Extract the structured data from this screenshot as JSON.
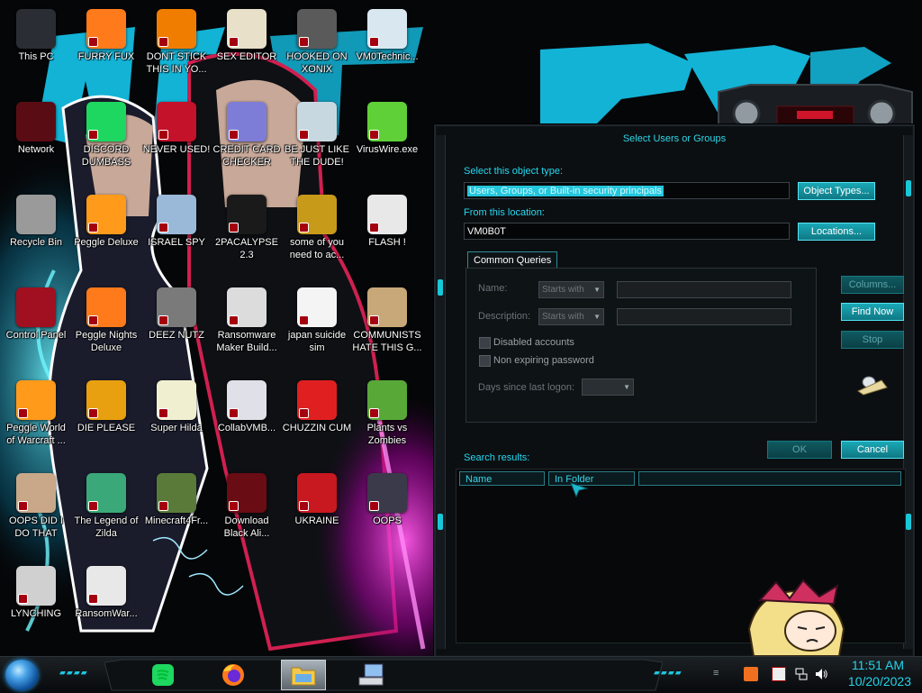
{
  "desktop": {
    "icons": [
      {
        "label": "This PC",
        "icon": "computer-icon",
        "color": "#2a2d33"
      },
      {
        "label": "FURRY FUX",
        "icon": "firefox-icon",
        "color": "#ff7a1a"
      },
      {
        "label": "DONT STICK THIS IN YO...",
        "icon": "vlc-cone-icon",
        "color": "#f07d00"
      },
      {
        "label": "SEX EDITOR",
        "icon": "hxd-editor-icon",
        "color": "#e8e0c8"
      },
      {
        "label": "HOOKED ON XONIX",
        "icon": "xonix-game-icon",
        "color": "#5a5a5a"
      },
      {
        "label": "VM0Technic...",
        "icon": "doctor-icon",
        "color": "#d9e8f0"
      },
      {
        "label": "Network",
        "icon": "network-orb-icon",
        "color": "#5a0c14"
      },
      {
        "label": "DISCORD DUMBASS",
        "icon": "spotify-icon",
        "color": "#1ed760"
      },
      {
        "label": "NEVER USED!",
        "icon": "devcpp-icon",
        "color": "#c4122a"
      },
      {
        "label": "CREDIT CARD CHECKER",
        "icon": "credit-card-icon",
        "color": "#7d7dd8"
      },
      {
        "label": "BE JUST LIKE THE DUDE!",
        "icon": "santa-icon",
        "color": "#c8d8e0"
      },
      {
        "label": "VirusWire.exe",
        "icon": "limewire-icon",
        "color": "#5fd038"
      },
      {
        "label": "Recycle Bin",
        "icon": "recycle-bin-icon",
        "color": "#9a9a9a"
      },
      {
        "label": "Peggle Deluxe",
        "icon": "peggle-icon",
        "color": "#ff9a1a"
      },
      {
        "label": "ISRAEL SPY",
        "icon": "network-card-icon",
        "color": "#9ab8d8"
      },
      {
        "label": "2PACALYPSE 2.3",
        "icon": "terminal-icon",
        "color": "#1a1a1a"
      },
      {
        "label": "some of you need to ac...",
        "icon": "beaver-icon",
        "color": "#c89a1a"
      },
      {
        "label": "FLASH !",
        "icon": "flash-icon",
        "color": "#e8e8e8"
      },
      {
        "label": "Control Panel",
        "icon": "control-panel-icon",
        "color": "#a01020"
      },
      {
        "label": "Peggle Nights Deluxe",
        "icon": "peggle-nights-icon",
        "color": "#ff7a1a"
      },
      {
        "label": "DEEZ NUTZ",
        "icon": "windows-stack-icon",
        "color": "#7a7a7a"
      },
      {
        "label": "Ransomware Maker Build...",
        "icon": "window-app-icon",
        "color": "#dcdcdc"
      },
      {
        "label": "japan suicide sim",
        "icon": "document-icon",
        "color": "#f4f4f4"
      },
      {
        "label": "COMMUNISTS HATE THIS G...",
        "icon": "money-bag-icon",
        "color": "#c8a878"
      },
      {
        "label": "Peggle World of Warcraft ...",
        "icon": "peggle-wow-icon",
        "color": "#ff9a1a"
      },
      {
        "label": "DIE PLEASE",
        "icon": "de-icon",
        "color": "#e8a010"
      },
      {
        "label": "Super Hilda",
        "icon": "pixel-ghost-icon",
        "color": "#f0f0d0"
      },
      {
        "label": "CollabVMB...",
        "icon": "monitor-icon",
        "color": "#e0e0e8"
      },
      {
        "label": "CHUZZIN CUM",
        "icon": "chuzzle-icon",
        "color": "#e02020"
      },
      {
        "label": "Plants vs Zombies",
        "icon": "plant-icon",
        "color": "#58a838"
      },
      {
        "label": "OOPS DID I DO THAT",
        "icon": "portrait-icon",
        "color": "#c8a888"
      },
      {
        "label": "The Legend of Zilda",
        "icon": "zilda-icon",
        "color": "#3aa878"
      },
      {
        "label": "Minecraft4Fr...",
        "icon": "minecraft-block-icon",
        "color": "#5a7a3a"
      },
      {
        "label": "Download Black Ali...",
        "icon": "black-orb-icon",
        "color": "#6a0c14"
      },
      {
        "label": "UKRAINE",
        "icon": "radiation-icon",
        "color": "#c81820"
      },
      {
        "label": "OOPS",
        "icon": "book-icon",
        "color": "#3a3a4a"
      },
      {
        "label": "LYNCHING",
        "icon": "chain-icon",
        "color": "#d0d0d0"
      },
      {
        "label": "RansomWar...",
        "icon": "skull-icon",
        "color": "#e8e8e8"
      }
    ]
  },
  "dialog": {
    "title": "Select Users or Groups",
    "object_type_label": "Select this object type:",
    "object_type_value": "Users, Groups, or Built-in security principals",
    "object_types_button": "Object Types...",
    "location_label": "From this location:",
    "location_value": "VM0B0T",
    "locations_button": "Locations...",
    "tab_label": "Common Queries",
    "name_label": "Name:",
    "name_op": "Starts with",
    "description_label": "Description:",
    "description_op": "Starts with",
    "disabled_accounts": "Disabled accounts",
    "non_expiring_password": "Non expiring password",
    "days_since_label": "Days since last logon:",
    "columns_button": "Columns...",
    "find_now_button": "Find Now",
    "stop_button": "Stop",
    "ok_button": "OK",
    "cancel_button": "Cancel",
    "search_results_label": "Search results:",
    "col_name": "Name",
    "col_in_folder": "In Folder"
  },
  "clock": {
    "time": "11:51 AM",
    "date": "10/20/2023"
  },
  "colors": {
    "accent": "#22d4ea",
    "dialog_bg": "#0c0f12",
    "button": "#1aa8b6"
  }
}
